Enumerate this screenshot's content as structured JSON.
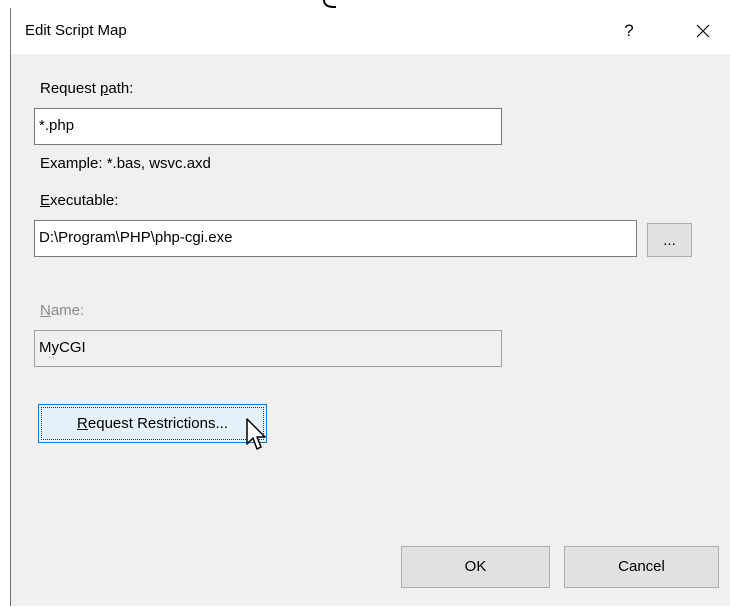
{
  "dialog": {
    "title": "Edit Script Map",
    "help_label": "?",
    "close_icon": "close-icon"
  },
  "request_path": {
    "label_pre": "Request ",
    "label_accel": "p",
    "label_post": "ath:",
    "value": "*.php",
    "example": "Example: *.bas, wsvc.axd"
  },
  "executable": {
    "label_accel": "E",
    "label_post": "xecutable:",
    "value": "D:\\Program\\PHP\\php-cgi.exe",
    "browse_label": "..."
  },
  "name": {
    "label_accel": "N",
    "label_post": "ame:",
    "value": "MyCGI",
    "enabled": false
  },
  "buttons": {
    "restrictions_accel": "R",
    "restrictions_post": "equest Restrictions...",
    "ok_label": "OK",
    "cancel_label": "Cancel"
  },
  "colors": {
    "dialog_bg": "#f0f0f0",
    "titlebar_bg": "#ffffff",
    "focus_border": "#0078d7",
    "focus_bg": "#e5f1fb",
    "disabled_text": "#8a8a8a"
  },
  "icons": {
    "cursor": "mouse-pointer-icon"
  }
}
